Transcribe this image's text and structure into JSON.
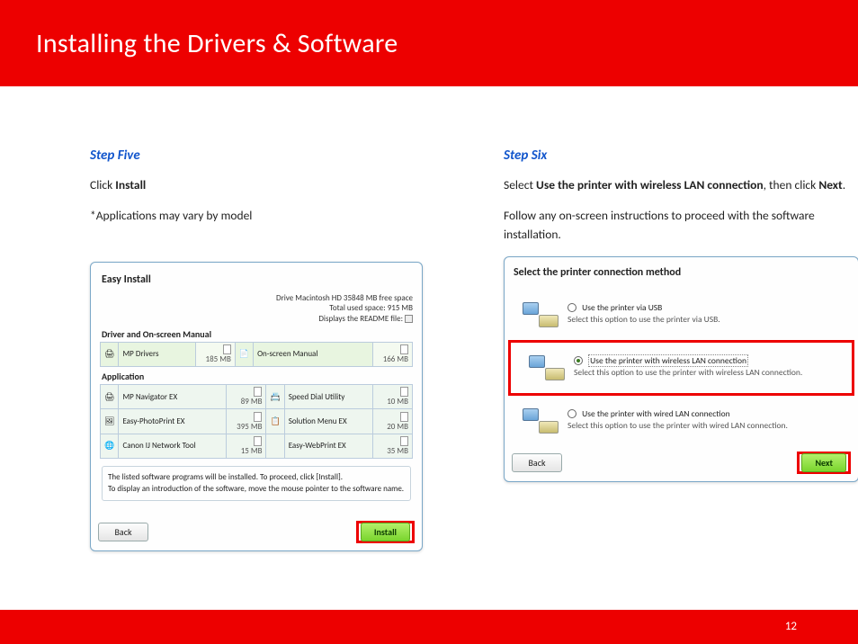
{
  "header": {
    "title": "Installing  the Drivers & Software"
  },
  "step5": {
    "title": "Step Five",
    "line1_a": "Click ",
    "line1_b": "Install",
    "line2": "*Applications may vary by model",
    "dialog": {
      "title": "Easy Install",
      "disk1": "Drive Macintosh HD 35848 MB free space",
      "disk2": "Total used space: 915 MB",
      "disk3": "Displays the README file:",
      "sec1": "Driver and On-screen Manual",
      "row_a1_name": "MP Drivers",
      "row_a1_size": "185 MB",
      "row_a2_name": "On-screen Manual",
      "row_a2_size": "166 MB",
      "sec2": "Application",
      "row_b1_name": "MP Navigator EX",
      "row_b1_size": "89 MB",
      "row_b2_name": "Speed Dial Utility",
      "row_b2_size": "10 MB",
      "row_b3_name": "Easy-PhotoPrint EX",
      "row_b3_size": "395 MB",
      "row_b4_name": "Solution Menu EX",
      "row_b4_size": "20 MB",
      "row_b5_name": "Canon IJ Network Tool",
      "row_b5_size": "15 MB",
      "row_b6_name": "Easy-WebPrint EX",
      "row_b6_size": "35 MB",
      "notice1": "The listed software programs will be installed. To proceed, click [Install].",
      "notice2": "To display an introduction of the software, move the mouse pointer to the software name.",
      "back": "Back",
      "install": "Install"
    }
  },
  "step6": {
    "title": "Step Six",
    "line1_a": "Select ",
    "line1_b": "Use the printer with wireless LAN connection",
    "line1_c": ", then click ",
    "line1_d": "Next",
    "line1_e": ".",
    "line2": "Follow any on-screen instructions to proceed with the software installation.",
    "dialog": {
      "title": "Select the printer connection method",
      "opt1_main": "Use the printer via USB",
      "opt1_sub": "Select this option to use the printer via USB.",
      "opt2_main": "Use the printer with wireless LAN connection",
      "opt2_sub": "Select this option to use the printer with wireless LAN connection.",
      "opt3_main": "Use the printer with wired LAN connection",
      "opt3_sub": "Select this option to use the printer with wired LAN connection.",
      "back": "Back",
      "next": "Next"
    }
  },
  "page_number": "12"
}
